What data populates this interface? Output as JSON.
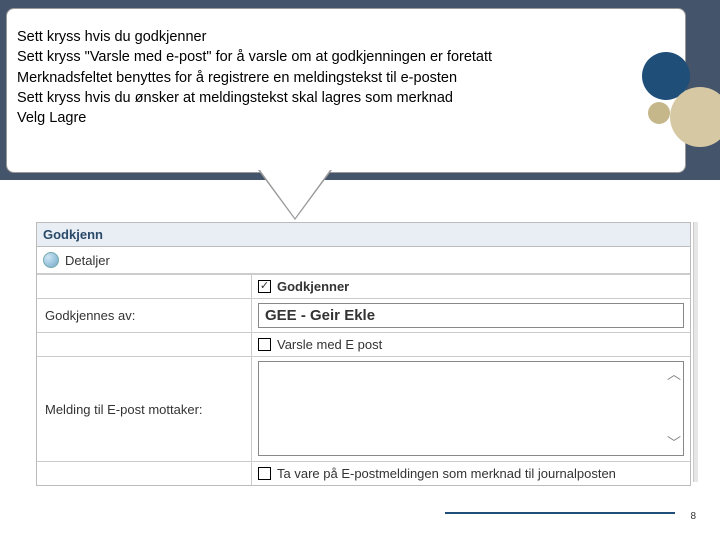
{
  "callout": {
    "lines": [
      "Sett kryss hvis du godkjenner",
      "Sett kryss \"Varsle med e-post\" for å varsle om at godkjenningen er foretatt",
      "Merknadsfeltet benyttes for å registrere en meldingstekst til e-posten",
      "Sett kryss hvis du ønsker at meldingstekst skal lagres som merknad",
      "Velg Lagre"
    ]
  },
  "form": {
    "title": "Godkjenn",
    "details_label": "Detaljer",
    "approver_checkbox_label": "Godkjenner",
    "approver_checkbox_checked": "✓",
    "approved_by_label": "Godkjennes av:",
    "approved_by_value": "GEE - Geir Ekle",
    "notify_checkbox_label": "Varsle med E post",
    "message_label": "Melding til E-post mottaker:",
    "keep_checkbox_label": "Ta vare på E-postmeldingen som merknad til journalposten"
  },
  "page_number": "8"
}
